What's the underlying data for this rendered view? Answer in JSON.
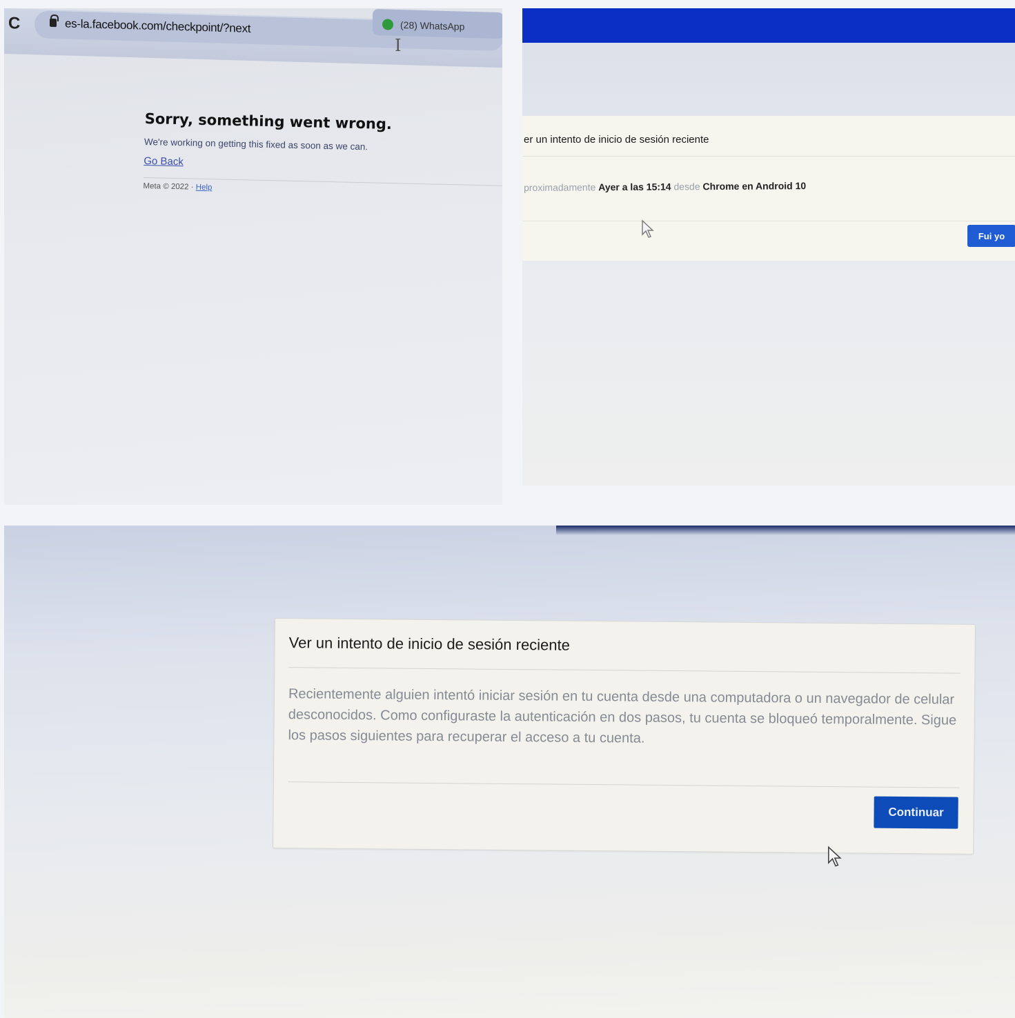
{
  "panel_error": {
    "tab_title": "(28) WhatsApp",
    "url": "es-la.facebook.com/checkpoint/?next",
    "heading": "Sorry, something went wrong.",
    "subtext": "We're working on getting this fixed as soon as we can.",
    "go_back": "Go Back",
    "footer": "Meta © 2022 · ",
    "help": "Help"
  },
  "panel_detail": {
    "title": "er un intento de inicio de sesión reciente",
    "prefix": "proximadamente ",
    "time": "Ayer a las 15:14",
    "from_word": " desde ",
    "device": "Chrome en Android 10",
    "button": "Fui yo"
  },
  "panel_checkpoint": {
    "title": "Ver un intento de inicio de sesión reciente",
    "body": "Recientemente alguien intentó iniciar sesión en tu cuenta desde una computadora o un navegador de celular desconocidos. Como configuraste la autenticación en dos pasos, tu cuenta se bloqueó temporalmente. Sigue los pasos siguientes para recuperar el acceso a tu cuenta.",
    "button": "Continuar"
  },
  "colors": {
    "facebook_blue": "#0b2fc4",
    "button_blue": "#0c4bb8",
    "link_blue": "#3b4fa8"
  }
}
